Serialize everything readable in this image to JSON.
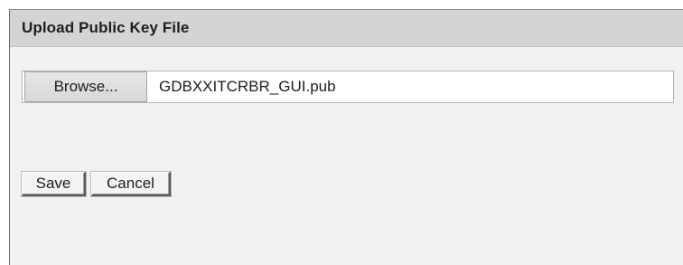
{
  "panel": {
    "title": "Upload Public Key File"
  },
  "file_input": {
    "browse_label": "Browse...",
    "file_name": "GDBXXITCRBR_GUI.pub"
  },
  "actions": {
    "save_label": "Save",
    "cancel_label": "Cancel"
  }
}
